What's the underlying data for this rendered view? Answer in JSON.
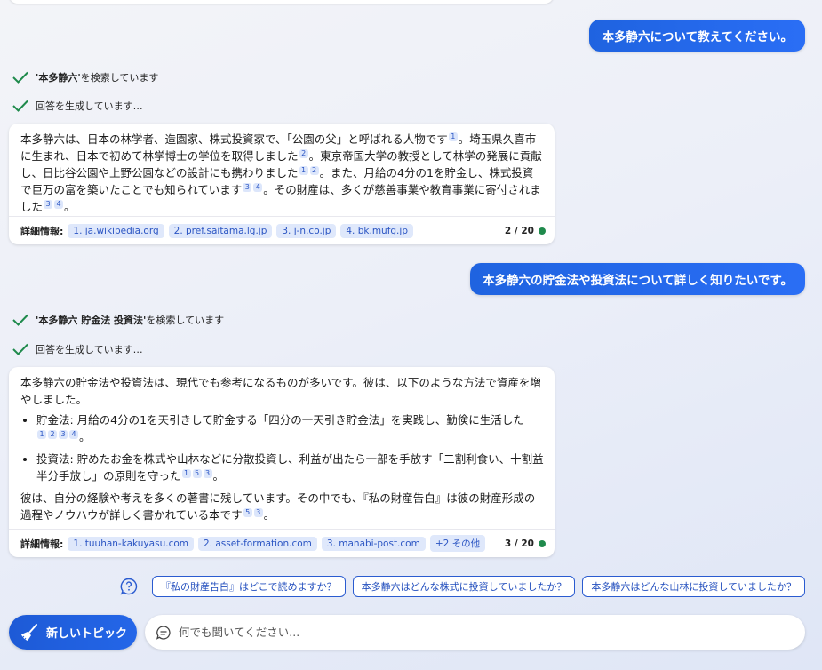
{
  "conversation": {
    "user_message_1": "本多静六について教えてください。",
    "search_1": {
      "query": "'本多静六'",
      "suffix": " を検索しています"
    },
    "generating_1": "回答を生成しています…",
    "answer_1": {
      "t1": "本多静六は、日本の林学者、造園家、株式投資家で、「公園の父」と呼ばれる人物です",
      "c1": [
        "1"
      ],
      "t2": "。埼玉県久喜市に生まれ、日本で初めて林学博士の学位を取得しました",
      "c2": [
        "2"
      ],
      "t3": "。東京帝国大学の教授として林学の発展に貢献し、日比谷公園や上野公園などの設計にも携わりました",
      "c3": [
        "1",
        "2"
      ],
      "t4": "。また、月給の4分の1を貯金し、株式投資で巨万の富を築いたことでも知られています",
      "c4": [
        "3",
        "4"
      ],
      "t5": "。その財産は、多くが慈善事業や教育事業に寄付されました",
      "c5": [
        "3",
        "4"
      ],
      "t6": "。",
      "footer_label": "詳細情報:",
      "links": [
        "1. ja.wikipedia.org",
        "2. pref.saitama.lg.jp",
        "3. j-n.co.jp",
        "4. bk.mufg.jp"
      ],
      "counter": "2 / 20"
    },
    "user_message_2": "本多静六の貯金法や投資法について詳しく知りたいです。",
    "search_2": {
      "query": "'本多静六 貯金法 投資法'",
      "suffix": " を検索しています"
    },
    "generating_2": "回答を生成しています…",
    "answer_2": {
      "intro": "本多静六の貯金法や投資法は、現代でも参考になるものが多いです。彼は、以下のような方法で資産を増やしました。",
      "b1_text": "貯金法: 月給の4分の1を天引きして貯金する「四分の一天引き貯金法」を実践し、勤倹に生活した",
      "b1_cites": [
        "1",
        "2",
        "3",
        "4"
      ],
      "b1_end": "。",
      "b2_text": "投資法: 貯めたお金を株式や山林などに分散投資し、利益が出たら一部を手放す「二割利食い、十割益半分手放し」の原則を守った",
      "b2_cites": [
        "1",
        "5",
        "3"
      ],
      "b2_end": "。",
      "outro": "彼は、自分の経験や考えを多くの著書に残しています。その中でも、『私の財産告白』は彼の財産形成の過程やノウハウが詳しく書かれている本です",
      "outro_cites": [
        "5",
        "3"
      ],
      "outro_end": "。",
      "footer_label": "詳細情報:",
      "links": [
        "1. tuuhan-kakuyasu.com",
        "2. asset-formation.com",
        "3. manabi-post.com",
        "+2 その他"
      ],
      "counter": "3 / 20"
    }
  },
  "suggestions": [
    "『私の財産告白』はどこで読めますか？",
    "本多静六はどんな株式に投資していましたか？",
    "本多静六はどんな山林に投資していましたか？"
  ],
  "new_topic_label": "新しいトピック",
  "input": {
    "placeholder": "何でも聞いてください..."
  },
  "colors": {
    "accent": "#1f63e0",
    "check": "#1f8a4c",
    "chip_bg": "#dfe8fb"
  }
}
